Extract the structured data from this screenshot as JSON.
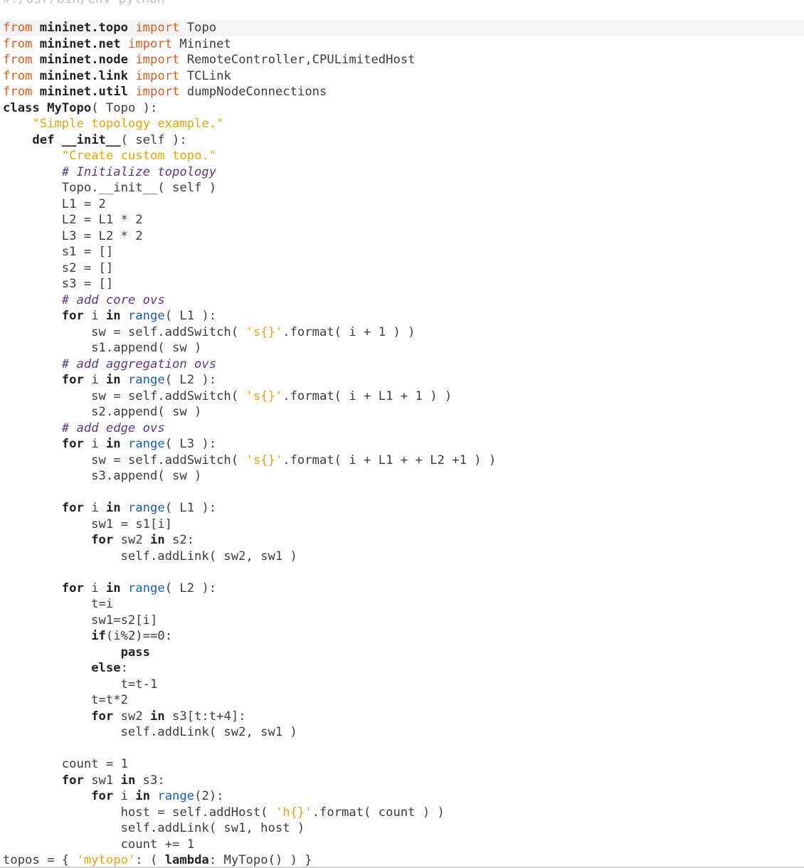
{
  "header_path": "#!/usr/bin/env python",
  "code_lines": [
    [
      [
        "kw",
        "from"
      ],
      [
        "t",
        " "
      ],
      [
        "kb",
        "mininet.topo"
      ],
      [
        "t",
        " "
      ],
      [
        "kw",
        "import"
      ],
      [
        "t",
        " Topo"
      ]
    ],
    [
      [
        "kw",
        "from"
      ],
      [
        "t",
        " "
      ],
      [
        "kb",
        "mininet.net"
      ],
      [
        "t",
        " "
      ],
      [
        "kw",
        "import"
      ],
      [
        "t",
        " Mininet"
      ]
    ],
    [
      [
        "kw",
        "from"
      ],
      [
        "t",
        " "
      ],
      [
        "kb",
        "mininet.node"
      ],
      [
        "t",
        " "
      ],
      [
        "kw",
        "import"
      ],
      [
        "t",
        " RemoteController,CPULimitedHost"
      ]
    ],
    [
      [
        "kw",
        "from"
      ],
      [
        "t",
        " "
      ],
      [
        "kb",
        "mininet.link"
      ],
      [
        "t",
        " "
      ],
      [
        "kw",
        "import"
      ],
      [
        "t",
        " TCLink"
      ]
    ],
    [
      [
        "kw",
        "from"
      ],
      [
        "t",
        " "
      ],
      [
        "kb",
        "mininet.util"
      ],
      [
        "t",
        " "
      ],
      [
        "kw",
        "import"
      ],
      [
        "t",
        " dumpNodeConnections"
      ]
    ],
    [
      [
        "kb",
        "class"
      ],
      [
        "t",
        " "
      ],
      [
        "kb",
        "MyTopo"
      ],
      [
        "t",
        "( Topo ):"
      ]
    ],
    [
      [
        "t",
        "    "
      ],
      [
        "st",
        "\"Simple topology example.\""
      ]
    ],
    [
      [
        "t",
        "    "
      ],
      [
        "kb",
        "def"
      ],
      [
        "t",
        " "
      ],
      [
        "kb",
        "__init__"
      ],
      [
        "t",
        "( self ):"
      ]
    ],
    [
      [
        "t",
        "        "
      ],
      [
        "st",
        "\"Create custom topo.\""
      ]
    ],
    [
      [
        "t",
        "        "
      ],
      [
        "cm",
        "# Initialize topology"
      ]
    ],
    [
      [
        "t",
        "        Topo.__init__( self )"
      ]
    ],
    [
      [
        "t",
        "        L1 = "
      ],
      [
        "nu",
        "2"
      ]
    ],
    [
      [
        "t",
        "        L2 = L1 * "
      ],
      [
        "nu",
        "2"
      ]
    ],
    [
      [
        "t",
        "        L3 = L2 * "
      ],
      [
        "nu",
        "2"
      ]
    ],
    [
      [
        "t",
        "        s1 = []"
      ]
    ],
    [
      [
        "t",
        "        s2 = []"
      ]
    ],
    [
      [
        "t",
        "        s3 = []"
      ]
    ],
    [
      [
        "t",
        "        "
      ],
      [
        "cm",
        "# add core ovs"
      ]
    ],
    [
      [
        "t",
        "        "
      ],
      [
        "kb",
        "for"
      ],
      [
        "t",
        " i "
      ],
      [
        "kb",
        "in"
      ],
      [
        "t",
        " "
      ],
      [
        "bi",
        "range"
      ],
      [
        "t",
        "( L1 ):"
      ]
    ],
    [
      [
        "t",
        "            sw = self.addSwitch( "
      ],
      [
        "st",
        "'s{}'"
      ],
      [
        "t",
        ".format( i + "
      ],
      [
        "nu",
        "1"
      ],
      [
        "t",
        " ) )"
      ]
    ],
    [
      [
        "t",
        "            s1.append( sw )"
      ]
    ],
    [
      [
        "t",
        "        "
      ],
      [
        "cm",
        "# add aggregation ovs"
      ]
    ],
    [
      [
        "t",
        "        "
      ],
      [
        "kb",
        "for"
      ],
      [
        "t",
        " i "
      ],
      [
        "kb",
        "in"
      ],
      [
        "t",
        " "
      ],
      [
        "bi",
        "range"
      ],
      [
        "t",
        "( L2 ):"
      ]
    ],
    [
      [
        "t",
        "            sw = self.addSwitch( "
      ],
      [
        "st",
        "'s{}'"
      ],
      [
        "t",
        ".format( i + L1 + "
      ],
      [
        "nu",
        "1"
      ],
      [
        "t",
        " ) )"
      ]
    ],
    [
      [
        "t",
        "            s2.append( sw )"
      ]
    ],
    [
      [
        "t",
        "        "
      ],
      [
        "cm",
        "# add edge ovs"
      ]
    ],
    [
      [
        "t",
        "        "
      ],
      [
        "kb",
        "for"
      ],
      [
        "t",
        " i "
      ],
      [
        "kb",
        "in"
      ],
      [
        "t",
        " "
      ],
      [
        "bi",
        "range"
      ],
      [
        "t",
        "( L3 ):"
      ]
    ],
    [
      [
        "t",
        "            sw = self.addSwitch( "
      ],
      [
        "st",
        "'s{}'"
      ],
      [
        "t",
        ".format( i + L1 + + L2 +"
      ],
      [
        "nu",
        "1"
      ],
      [
        "t",
        " ) )"
      ]
    ],
    [
      [
        "t",
        "            s3.append( sw )"
      ]
    ],
    [
      [
        "t",
        ""
      ]
    ],
    [
      [
        "t",
        "        "
      ],
      [
        "kb",
        "for"
      ],
      [
        "t",
        " i "
      ],
      [
        "kb",
        "in"
      ],
      [
        "t",
        " "
      ],
      [
        "bi",
        "range"
      ],
      [
        "t",
        "( L1 ):"
      ]
    ],
    [
      [
        "t",
        "            sw1 = s1[i]"
      ]
    ],
    [
      [
        "t",
        "            "
      ],
      [
        "kb",
        "for"
      ],
      [
        "t",
        " sw2 "
      ],
      [
        "kb",
        "in"
      ],
      [
        "t",
        " s2:"
      ]
    ],
    [
      [
        "t",
        "                self.addLink( sw2, sw1 )"
      ]
    ],
    [
      [
        "t",
        ""
      ]
    ],
    [
      [
        "t",
        "        "
      ],
      [
        "kb",
        "for"
      ],
      [
        "t",
        " i "
      ],
      [
        "kb",
        "in"
      ],
      [
        "t",
        " "
      ],
      [
        "bi",
        "range"
      ],
      [
        "t",
        "( L2 ):"
      ]
    ],
    [
      [
        "t",
        "            t=i"
      ]
    ],
    [
      [
        "t",
        "            sw1=s2[i]"
      ]
    ],
    [
      [
        "t",
        "            "
      ],
      [
        "kb",
        "if"
      ],
      [
        "t",
        "(i%"
      ],
      [
        "nu",
        "2"
      ],
      [
        "t",
        ")=="
      ],
      [
        "nu",
        "0"
      ],
      [
        "t",
        ":"
      ]
    ],
    [
      [
        "t",
        "                "
      ],
      [
        "kb",
        "pass"
      ]
    ],
    [
      [
        "t",
        "            "
      ],
      [
        "kb",
        "else"
      ],
      [
        "t",
        ":"
      ]
    ],
    [
      [
        "t",
        "                t=t-"
      ],
      [
        "nu",
        "1"
      ]
    ],
    [
      [
        "t",
        "            t=t*"
      ],
      [
        "nu",
        "2"
      ]
    ],
    [
      [
        "t",
        "            "
      ],
      [
        "kb",
        "for"
      ],
      [
        "t",
        " sw2 "
      ],
      [
        "kb",
        "in"
      ],
      [
        "t",
        " s3[t:t+"
      ],
      [
        "nu",
        "4"
      ],
      [
        "t",
        "]:"
      ]
    ],
    [
      [
        "t",
        "                self.addLink( sw2, sw1 )"
      ]
    ],
    [
      [
        "t",
        ""
      ]
    ],
    [
      [
        "t",
        "        count = "
      ],
      [
        "nu",
        "1"
      ]
    ],
    [
      [
        "t",
        "        "
      ],
      [
        "kb",
        "for"
      ],
      [
        "t",
        " sw1 "
      ],
      [
        "kb",
        "in"
      ],
      [
        "t",
        " s3:"
      ]
    ],
    [
      [
        "t",
        "            "
      ],
      [
        "kb",
        "for"
      ],
      [
        "t",
        " i "
      ],
      [
        "kb",
        "in"
      ],
      [
        "t",
        " "
      ],
      [
        "bi",
        "range"
      ],
      [
        "t",
        "("
      ],
      [
        "nu",
        "2"
      ],
      [
        "t",
        "):"
      ]
    ],
    [
      [
        "t",
        "                host = self.addHost( "
      ],
      [
        "st",
        "'h{}'"
      ],
      [
        "t",
        ".format( count ) )"
      ]
    ],
    [
      [
        "t",
        "                self.addLink( sw1, host )"
      ]
    ],
    [
      [
        "t",
        "                count += "
      ],
      [
        "nu",
        "1"
      ]
    ],
    [
      [
        "t",
        "topos = { "
      ],
      [
        "st",
        "'mytopo'"
      ],
      [
        "t",
        ": ( "
      ],
      [
        "kb",
        "lambda"
      ],
      [
        "t",
        ": MyTopo() ) }"
      ]
    ]
  ],
  "colors": {
    "keyword_orange": "#e05a1b",
    "keyword_bold": "#222222",
    "builtin_blue": "#1a5fb4",
    "string_yellow": "#e5a50a",
    "comment_purple": "#613583",
    "text_gray": "#3c3c3c",
    "current_line": "#f4f4f4"
  }
}
